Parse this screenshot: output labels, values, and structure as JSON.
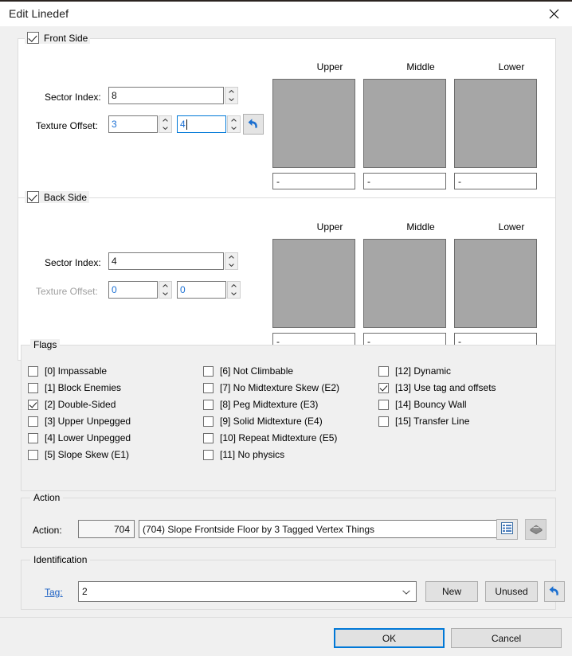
{
  "window": {
    "title": "Edit Linedef",
    "close_icon": "close-icon"
  },
  "front_side": {
    "title": "Front Side",
    "checked": true,
    "sector_index_label": "Sector Index:",
    "sector_index_value": "8",
    "texture_offset_label": "Texture Offset:",
    "offset_x_value": "3",
    "offset_y_value": "4",
    "revert_icon": "revert-arrow-icon",
    "textures": [
      {
        "header": "Upper",
        "name": "-"
      },
      {
        "header": "Middle",
        "name": "-"
      },
      {
        "header": "Lower",
        "name": "-"
      }
    ]
  },
  "back_side": {
    "title": "Back Side",
    "checked": true,
    "sector_index_label": "Sector Index:",
    "sector_index_value": "4",
    "texture_offset_label": "Texture Offset:",
    "offset_x_value": "0",
    "offset_y_value": "0",
    "textures": [
      {
        "header": "Upper",
        "name": "-"
      },
      {
        "header": "Middle",
        "name": "-"
      },
      {
        "header": "Lower",
        "name": "-"
      }
    ]
  },
  "flags": {
    "title": "Flags",
    "column1": [
      {
        "label": "[0] Impassable",
        "checked": false
      },
      {
        "label": "[1] Block Enemies",
        "checked": false
      },
      {
        "label": "[2] Double-Sided",
        "checked": true
      },
      {
        "label": "[3] Upper Unpegged",
        "checked": false
      },
      {
        "label": "[4] Lower Unpegged",
        "checked": false
      },
      {
        "label": "[5] Slope Skew (E1)",
        "checked": false
      }
    ],
    "column2": [
      {
        "label": "[6] Not Climbable",
        "checked": false
      },
      {
        "label": "[7] No Midtexture Skew (E2)",
        "checked": false
      },
      {
        "label": "[8] Peg Midtexture (E3)",
        "checked": false
      },
      {
        "label": "[9] Solid Midtexture (E4)",
        "checked": false
      },
      {
        "label": "[10] Repeat Midtexture (E5)",
        "checked": false
      },
      {
        "label": "[11] No physics",
        "checked": false
      }
    ],
    "column3": [
      {
        "label": "[12] Dynamic",
        "checked": false
      },
      {
        "label": "[13] Use tag and offsets",
        "checked": true
      },
      {
        "label": "[14] Bouncy Wall",
        "checked": false
      },
      {
        "label": "[15] Transfer Line",
        "checked": false
      }
    ]
  },
  "action": {
    "title": "Action",
    "label": "Action:",
    "number": "704",
    "description": "(704) Slope Frontside Floor by 3 Tagged Vertex Things",
    "browse_icon": "list-browse-icon",
    "slope_icon": "slope-stack-icon"
  },
  "identification": {
    "title": "Identification",
    "tag_label": "Tag:",
    "tag_value": "2",
    "new_button": "New",
    "unused_button": "Unused",
    "revert_icon": "revert-arrow-icon"
  },
  "footer": {
    "ok": "OK",
    "cancel": "Cancel"
  },
  "colors": {
    "accent": "#0078d7",
    "link": "#1b60c4",
    "value_blue": "#1a6fd4",
    "texture_fill": "#a6a6a6",
    "dialog_bg": "#f0f0f0"
  }
}
